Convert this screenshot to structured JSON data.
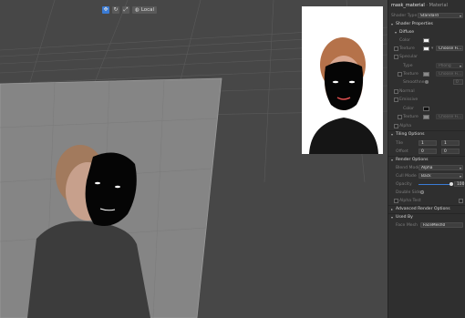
{
  "toolbar": {
    "local_label": "Local"
  },
  "panel": {
    "title": "mask_material",
    "subtitle": " · Material",
    "shader_type": {
      "label": "Shader Type",
      "value": "Standard"
    },
    "shader_properties": "Shader Properties",
    "diffuse": "Diffuse",
    "diffuse_color": "Color",
    "diffuse_texture": {
      "label": "Texture",
      "button": "Choose Fi..."
    },
    "specular": "Specular",
    "specular_type": {
      "label": "Type",
      "value": "Phong"
    },
    "specular_texture": {
      "label": "Texture",
      "button": "Choose Fi..."
    },
    "smoothness": {
      "label": "Smoothness",
      "value": "0"
    },
    "normal": "Normal",
    "emissive": "Emissive",
    "emissive_color": "Color",
    "emissive_texture": {
      "label": "Texture",
      "button": "Choose Fi..."
    },
    "alpha": "Alpha",
    "tiling": "Tiling Options",
    "tile": {
      "label": "Tile",
      "x": "1",
      "y": "1"
    },
    "offset": {
      "label": "Offset",
      "x": "0",
      "y": "0"
    },
    "render_options": "Render Options",
    "blend_mode": {
      "label": "Blend Mode",
      "value": "Alpha"
    },
    "cull_mode": {
      "label": "Cull Mode",
      "value": "Back"
    },
    "opacity": {
      "label": "Opacity",
      "value": "100",
      "level": 1.0
    },
    "double_sided": "Double Sided",
    "alpha_test": "Alpha Test",
    "advanced": "Advanced Render Options",
    "used_by": "Used By",
    "face_mesh": {
      "label": "Face Mesh",
      "value": "FaceMesh0"
    }
  },
  "colors": {
    "accent": "#3a7bd5",
    "panel_bg": "#2f2f2f",
    "viewport_bg": "#474747"
  }
}
